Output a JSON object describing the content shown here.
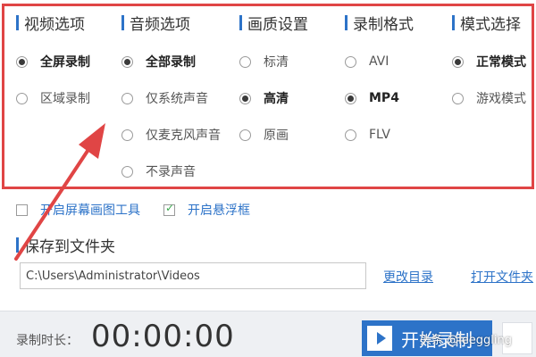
{
  "columns": [
    {
      "title": "视频选项",
      "options": [
        {
          "label": "全屏录制",
          "selected": true
        },
        {
          "label": "区域录制",
          "selected": false
        }
      ]
    },
    {
      "title": "音频选项",
      "options": [
        {
          "label": "全部录制",
          "selected": true
        },
        {
          "label": "仅系统声音",
          "selected": false
        },
        {
          "label": "仅麦克风声音",
          "selected": false
        },
        {
          "label": "不录声音",
          "selected": false
        }
      ]
    },
    {
      "title": "画质设置",
      "options": [
        {
          "label": "标清",
          "selected": false
        },
        {
          "label": "高清",
          "selected": true
        },
        {
          "label": "原画",
          "selected": false
        }
      ]
    },
    {
      "title": "录制格式",
      "options": [
        {
          "label": "AVI",
          "selected": false
        },
        {
          "label": "MP4",
          "selected": true
        },
        {
          "label": "FLV",
          "selected": false
        }
      ]
    },
    {
      "title": "模式选择",
      "options": [
        {
          "label": "正常模式",
          "selected": true
        },
        {
          "label": "游戏模式",
          "selected": false
        }
      ]
    }
  ],
  "checkboxes": [
    {
      "label": "开启屏幕画图工具",
      "checked": false
    },
    {
      "label": "开启悬浮框",
      "checked": true
    }
  ],
  "save": {
    "title": "保存到文件夹",
    "path": "C:\\Users\\Administrator\\Videos",
    "change_dir_link": "更改目录",
    "open_file_link": "打开文件夹"
  },
  "footer": {
    "duration_label": "录制时长：",
    "duration_value": "00:00:00",
    "start_label": "开始录制"
  },
  "watermark": "头条 @leeggling",
  "colors": {
    "accent": "#2d73c8",
    "highlight_border": "#e04545",
    "check_green": "#3aa94d"
  }
}
